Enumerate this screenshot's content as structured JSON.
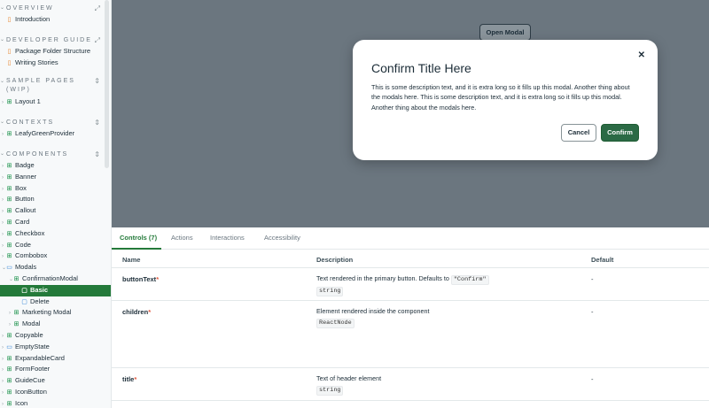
{
  "sidebar": {
    "sections": {
      "overview": {
        "title": "OVERVIEW",
        "items": [
          "Introduction"
        ]
      },
      "developer_guide": {
        "title": "DEVELOPER GUIDE",
        "items": [
          "Package Folder Structure",
          "Writing Stories"
        ]
      },
      "sample_pages": {
        "title": "SAMPLE PAGES",
        "title2": "(WIP)",
        "items": [
          "Layout 1"
        ]
      },
      "contexts": {
        "title": "CONTEXTS",
        "items": [
          "LeafyGreenProvider"
        ]
      },
      "components": {
        "title": "COMPONENTS",
        "items": [
          "Badge",
          "Banner",
          "Box",
          "Button",
          "Callout",
          "Card",
          "Checkbox",
          "Code",
          "Combobox",
          "Modals"
        ],
        "modals_children": {
          "confirmation_modal": "ConfirmationModal",
          "basic": "Basic",
          "delete": "Delete",
          "marketing_modal": "Marketing Modal",
          "modal": "Modal"
        },
        "items_after": [
          "Copyable",
          "EmptyState",
          "ExpandableCard",
          "FormFooter",
          "GuideCue",
          "IconButton",
          "Icon"
        ]
      }
    }
  },
  "canvas": {
    "open_modal_label": "Open Modal",
    "modal": {
      "title": "Confirm Title Here",
      "description": "This is some description text, and it is extra long so it fills up this modal. Another thing about the modals here. This is some description text, and it is extra long so it fills up this modal. Another thing about the modals here.",
      "cancel_label": "Cancel",
      "confirm_label": "Confirm",
      "close_glyph": "✕"
    }
  },
  "panel": {
    "tabs": [
      "Controls (7)",
      "Actions",
      "Interactions",
      "Accessibility"
    ],
    "columns": {
      "name": "Name",
      "description": "Description",
      "default": "Default"
    },
    "rows": [
      {
        "name": "buttonText",
        "required": "*",
        "description": "Text rendered in the primary button. Defaults to",
        "inline_code": "\"Confirm\"",
        "type": "string",
        "default": "-"
      },
      {
        "name": "children",
        "required": "*",
        "description": "Element rendered inside the component",
        "type": "ReactNode",
        "default": "-"
      },
      {
        "name": "title",
        "required": "*",
        "description": "Text of header element",
        "type": "string",
        "default": "-"
      }
    ]
  },
  "colors": {
    "accent": "#247a3a",
    "canvas_bg": "#6b767f",
    "required": "#e2583e"
  }
}
